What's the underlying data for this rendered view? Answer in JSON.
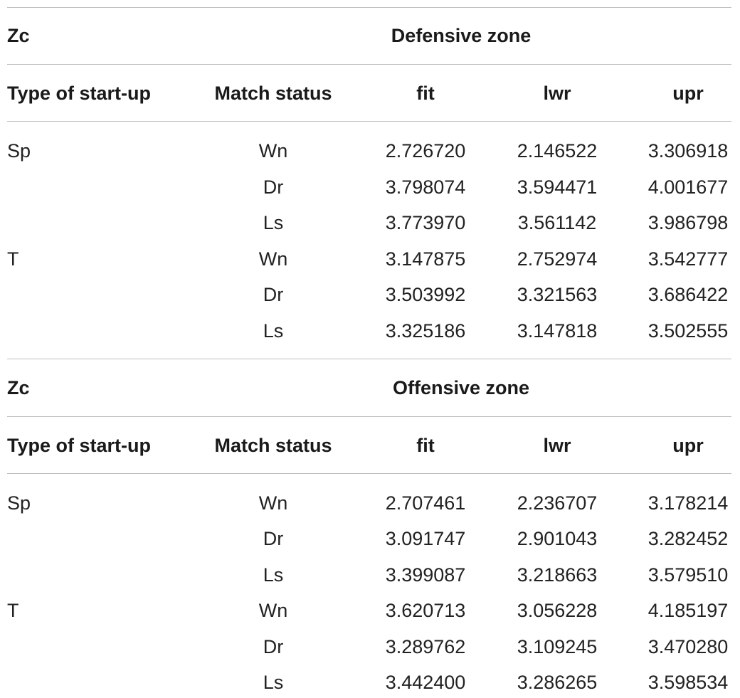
{
  "columns": {
    "type": "Type of start-up",
    "status": "Match status",
    "fit": "fit",
    "lwr": "lwr",
    "upr": "upr"
  },
  "sections": [
    {
      "label": "Zc",
      "zone": "Defensive zone",
      "rows": [
        {
          "type": "Sp",
          "status": "Wn",
          "fit": "2.726720",
          "lwr": "2.146522",
          "upr": "3.306918"
        },
        {
          "type": "",
          "status": "Dr",
          "fit": "3.798074",
          "lwr": "3.594471",
          "upr": "4.001677"
        },
        {
          "type": "",
          "status": "Ls",
          "fit": "3.773970",
          "lwr": "3.561142",
          "upr": "3.986798"
        },
        {
          "type": "T",
          "status": "Wn",
          "fit": "3.147875",
          "lwr": "2.752974",
          "upr": "3.542777"
        },
        {
          "type": "",
          "status": "Dr",
          "fit": "3.503992",
          "lwr": "3.321563",
          "upr": "3.686422"
        },
        {
          "type": "",
          "status": "Ls",
          "fit": "3.325186",
          "lwr": "3.147818",
          "upr": "3.502555"
        }
      ]
    },
    {
      "label": "Zc",
      "zone": "Offensive zone",
      "rows": [
        {
          "type": "Sp",
          "status": "Wn",
          "fit": "2.707461",
          "lwr": "2.236707",
          "upr": "3.178214"
        },
        {
          "type": "",
          "status": "Dr",
          "fit": "3.091747",
          "lwr": "2.901043",
          "upr": "3.282452"
        },
        {
          "type": "",
          "status": "Ls",
          "fit": "3.399087",
          "lwr": "3.218663",
          "upr": "3.579510"
        },
        {
          "type": "T",
          "status": "Wn",
          "fit": "3.620713",
          "lwr": "3.056228",
          "upr": "4.185197"
        },
        {
          "type": "",
          "status": "Dr",
          "fit": "3.289762",
          "lwr": "3.109245",
          "upr": "3.470280"
        },
        {
          "type": "",
          "status": "Ls",
          "fit": "3.442400",
          "lwr": "3.286265",
          "upr": "3.598534"
        }
      ]
    }
  ]
}
